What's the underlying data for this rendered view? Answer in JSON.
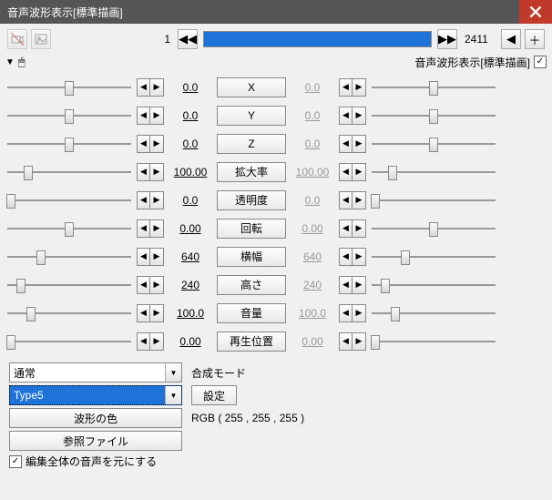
{
  "window": {
    "title": "音声波形表示[標準描画]"
  },
  "top": {
    "frame_start": "1",
    "frame_end": "2411",
    "timeline_fill_pct": 100,
    "sublabel": "音声波形表示[標準描画]",
    "subcheck": "✓"
  },
  "params": [
    {
      "name": "X",
      "valL": "0.0",
      "valR": "0.0",
      "thumbL": 50,
      "thumbR": 50
    },
    {
      "name": "Y",
      "valL": "0.0",
      "valR": "0.0",
      "thumbL": 50,
      "thumbR": 50
    },
    {
      "name": "Z",
      "valL": "0.0",
      "valR": "0.0",
      "thumbL": 50,
      "thumbR": 50
    },
    {
      "name": "拡大率",
      "valL": "100.00",
      "valR": "100.00",
      "thumbL": 18,
      "thumbR": 18
    },
    {
      "name": "透明度",
      "valL": "0.0",
      "valR": "0.0",
      "thumbL": 4,
      "thumbR": 4
    },
    {
      "name": "回転",
      "valL": "0.00",
      "valR": "0.00",
      "thumbL": 50,
      "thumbR": 50
    },
    {
      "name": "横幅",
      "valL": "640",
      "valR": "640",
      "thumbL": 28,
      "thumbR": 28
    },
    {
      "name": "高さ",
      "valL": "240",
      "valR": "240",
      "thumbL": 12,
      "thumbR": 12
    },
    {
      "name": "音量",
      "valL": "100.0",
      "valR": "100.0",
      "thumbL": 20,
      "thumbR": 20
    },
    {
      "name": "再生位置",
      "valL": "0.00",
      "valR": "0.00",
      "thumbL": 4,
      "thumbR": 4
    }
  ],
  "bottom": {
    "blend_mode_value": "通常",
    "blend_mode_label": "合成モード",
    "type_value": "Type5",
    "settings_btn": "設定",
    "wavecolor_btn": "波形の色",
    "rgb_label": "RGB ( 255 , 255 , 255 )",
    "reffile_btn": "参照ファイル",
    "editall_check": "✓",
    "editall_label": "編集全体の音声を元にする"
  },
  "chart_data": null
}
